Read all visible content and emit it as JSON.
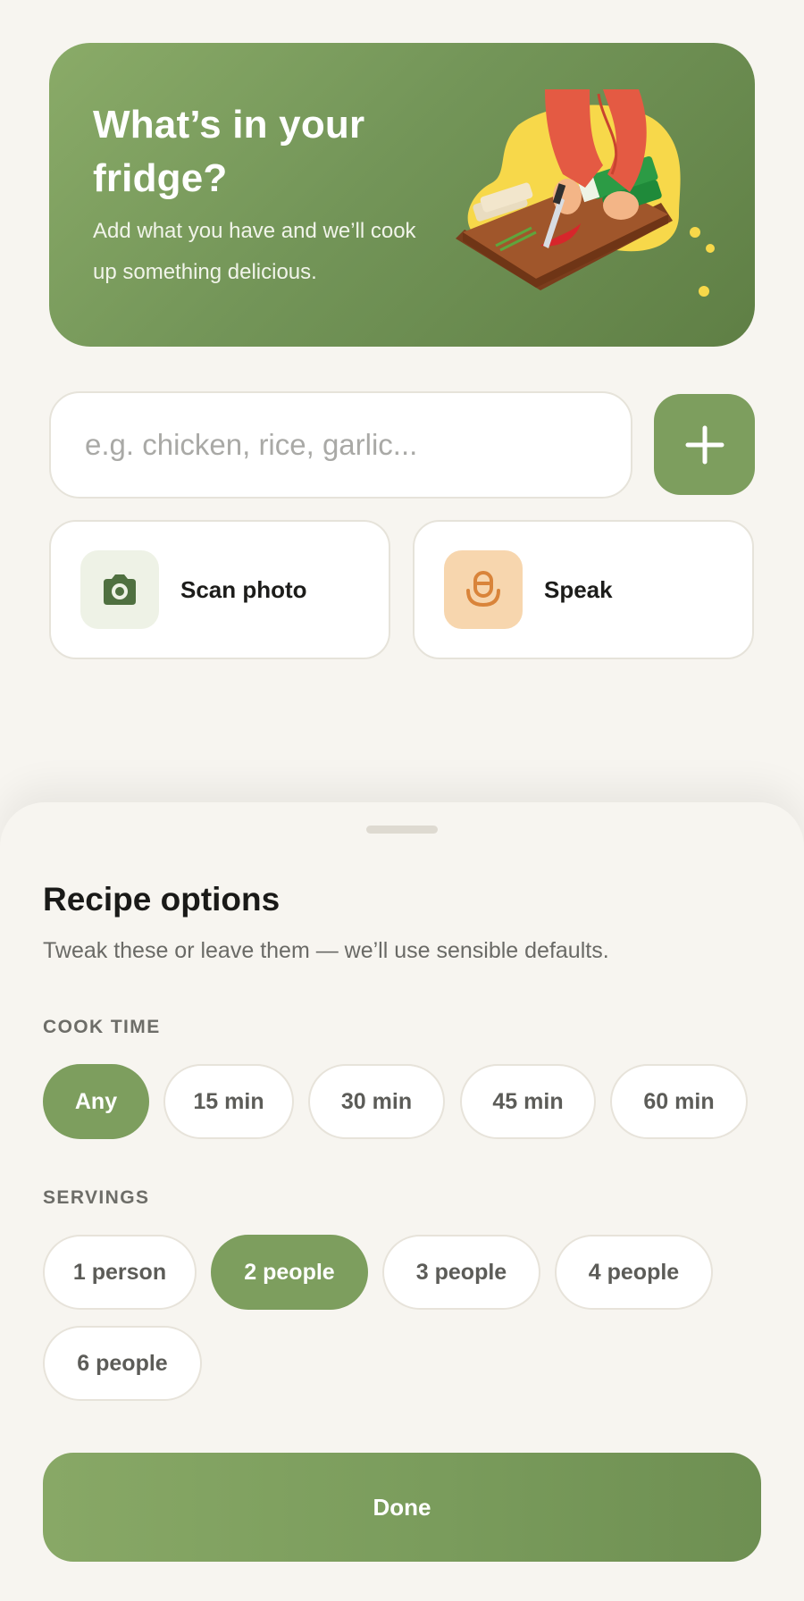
{
  "hero": {
    "title": "What’s in your fridge?",
    "subtitle": "Add what you have and we’ll cook up something delicious.",
    "illustration": "hands-chopping-vegetables-on-board"
  },
  "ingredient_input": {
    "placeholder": "e.g. chicken, rice, garlic...",
    "value": "",
    "add_icon": "plus-icon"
  },
  "actions": [
    {
      "label": "Scan photo",
      "icon": "camera-icon"
    },
    {
      "label": "Speak",
      "icon": "microphone-icon"
    }
  ],
  "sheet": {
    "title": "Recipe options",
    "subtitle": "Tweak these or leave them — we’ll use sensible defaults.",
    "cook_time": {
      "label": "COOK TIME",
      "options": [
        "Any",
        "15 min",
        "30 min",
        "45 min",
        "60 min"
      ],
      "selected": "Any"
    },
    "servings": {
      "label": "SERVINGS",
      "options": [
        "1 person",
        "2 people",
        "3 people",
        "4 people",
        "6 people"
      ],
      "selected": "2 people"
    },
    "done_label": "Done"
  },
  "colors": {
    "accent": "#7d9e5e",
    "background": "#f7f5f0",
    "speak_icon_bg": "#f7d6ae",
    "scan_icon_bg": "#eef2e6"
  }
}
